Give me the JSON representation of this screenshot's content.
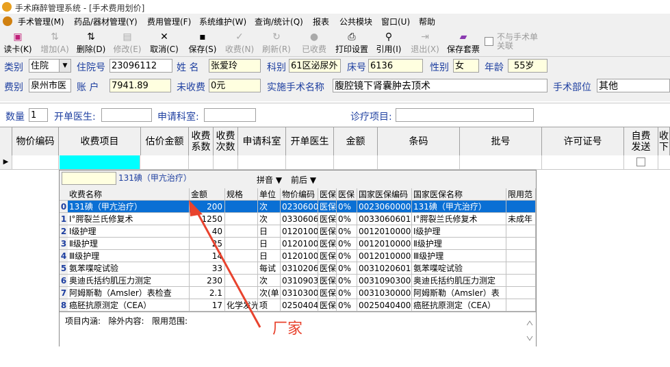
{
  "window": {
    "title": "手术麻醉管理系统 - [手术费用划价]"
  },
  "menu": [
    "手术管理(M)",
    "药品/器材管理(Y)",
    "费用管理(F)",
    "系统维护(W)",
    "查询/统计(Q)",
    "报表",
    "公共模块",
    "窗口(U)",
    "帮助"
  ],
  "toolbar": {
    "buttons": [
      {
        "label": "读卡(K)",
        "icon": "card-icon",
        "enabled": true
      },
      {
        "label": "增加(A)",
        "icon": "add-icon",
        "enabled": false
      },
      {
        "label": "删除(D)",
        "icon": "delete-icon",
        "enabled": true
      },
      {
        "label": "修改(E)",
        "icon": "edit-icon",
        "enabled": false
      },
      {
        "label": "取消(C)",
        "icon": "cancel-icon",
        "enabled": true
      },
      {
        "label": "保存(S)",
        "icon": "save-icon",
        "enabled": true
      },
      {
        "label": "收费(N)",
        "icon": "charge-icon",
        "enabled": false
      },
      {
        "label": "刷新(R)",
        "icon": "refresh-icon",
        "enabled": false
      },
      {
        "label": "已收费",
        "icon": "charged-icon",
        "enabled": false
      },
      {
        "label": "打印设置",
        "icon": "printer-icon",
        "enabled": true
      },
      {
        "label": "引用(I)",
        "icon": "reference-icon",
        "enabled": true
      },
      {
        "label": "退出(X)",
        "icon": "exit-icon",
        "enabled": false
      },
      {
        "label": "保存套票",
        "icon": "book-icon",
        "enabled": true
      }
    ],
    "unlink_label": "不与手术单关联"
  },
  "form": {
    "category_label": "类别",
    "category_value": "住院",
    "admission_label": "住院号",
    "admission_value": "23096112",
    "name_label": "姓  名",
    "name_value": "张爱玲",
    "dept_label": "科别",
    "dept_value": "61区泌尿外",
    "bed_label": "床号",
    "bed_value": "6136",
    "gender_label": "性别",
    "gender_value": "女",
    "age_label": "年龄",
    "age_value": "55岁",
    "feetype_label": "费别",
    "feetype_value": "泉州市医",
    "account_label": "账  户",
    "account_value": "7941.89",
    "unpaid_label": "未收费",
    "unpaid_value": "0元",
    "surgery_label": "实施手术名称",
    "surgery_value": "腹腔镜下肾囊肿去顶术",
    "site_label": "手术部位",
    "site_value": "其他",
    "qty_label": "数量",
    "qty_value": "1",
    "doctor_label": "开单医生:",
    "doctor_value": "",
    "applydept_label": "申请科室:",
    "applydept_value": "",
    "item_label": "诊疗项目:",
    "item_value": ""
  },
  "grid": {
    "headers": [
      "物价编码",
      "收费项目",
      "估价金额",
      "收费系数",
      "收费次数",
      "申请科室",
      "开单医生",
      "金额",
      "条码",
      "批号",
      "许可证号",
      "自费发送",
      "收下"
    ]
  },
  "popup": {
    "search_value": "",
    "current_item": "131碘（甲亢治疗）",
    "pinyin_label": "拼音",
    "order_label": "前后",
    "headers": [
      "收费名称",
      "金额",
      "规格",
      "单位",
      "物价编码",
      "医保",
      "医保",
      "国家医保编码",
      "国家医保名称",
      "限用范"
    ],
    "rows": [
      {
        "idx": "0",
        "name": "131碘（甲亢治疗）",
        "amount": "200",
        "spec": "",
        "unit": "次",
        "code": "0230600",
        "ins1": "医保",
        "ins2": "0%",
        "ncode": "00230600001",
        "nname": "131碘（甲亢治疗）",
        "limit": ""
      },
      {
        "idx": "1",
        "name": "Ⅰ°腭裂兰氏修复术",
        "amount": "1250",
        "spec": "",
        "unit": "次",
        "code": "0330606",
        "ins1": "医保",
        "ins2": "0%",
        "ncode": "00330606014",
        "nname": "Ⅰ°腭裂兰氏修复术",
        "limit": "未成年"
      },
      {
        "idx": "2",
        "name": "Ⅰ级护理",
        "amount": "40",
        "spec": "",
        "unit": "日",
        "code": "0120100",
        "ins1": "医保",
        "ins2": "0%",
        "ncode": "00120100003",
        "nname": "Ⅰ级护理",
        "limit": ""
      },
      {
        "idx": "3",
        "name": "Ⅱ级护理",
        "amount": "25",
        "spec": "",
        "unit": "日",
        "code": "0120100",
        "ins1": "医保",
        "ins2": "0%",
        "ncode": "00120100004",
        "nname": "Ⅱ级护理",
        "limit": ""
      },
      {
        "idx": "4",
        "name": "Ⅲ级护理",
        "amount": "14",
        "spec": "",
        "unit": "日",
        "code": "0120100",
        "ins1": "医保",
        "ins2": "0%",
        "ncode": "00120100005",
        "nname": "Ⅲ级护理",
        "limit": ""
      },
      {
        "idx": "5",
        "name": "氨苯喋啶试验",
        "amount": "33",
        "spec": "",
        "unit": "每试",
        "code": "0310206",
        "ins1": "医保",
        "ins2": "0%",
        "ncode": "00310206011",
        "nname": "氨苯喋啶试验",
        "limit": ""
      },
      {
        "idx": "6",
        "name": "奥迪氏括约肌压力测定",
        "amount": "230",
        "spec": "",
        "unit": "次",
        "code": "0310903",
        "ins1": "医保",
        "ins2": "0%",
        "ncode": "00310903002",
        "nname": "奥迪氏括约肌压力测定",
        "limit": ""
      },
      {
        "idx": "7",
        "name": "阿姆斯勒（Amsler）表检查",
        "amount": "2.1",
        "spec": "",
        "unit": "次(单",
        "code": "0310300",
        "ins1": "医保",
        "ins2": "0%",
        "ncode": "00310300006",
        "nname": "阿姆斯勒（Amsler）表",
        "limit": ""
      },
      {
        "idx": "8",
        "name": "癌胚抗原测定（CEA）",
        "amount": "17",
        "spec": "化学发光",
        "unit": "项",
        "code": "0250404",
        "ins1": "医保",
        "ins2": "0%",
        "ncode": "00250404001",
        "nname": "癌胚抗原测定（CEA）",
        "limit": ""
      }
    ],
    "footer": "项目内涵:   除外内容:   限用范围:"
  },
  "annotation": {
    "text": "厂家",
    "color": "#e8432e"
  },
  "colors": {
    "selected": "#0a6fd4",
    "current_cell": "#00ffff",
    "label_blue": "#1e3fa0",
    "readonly_bg": "#ffffe0"
  }
}
